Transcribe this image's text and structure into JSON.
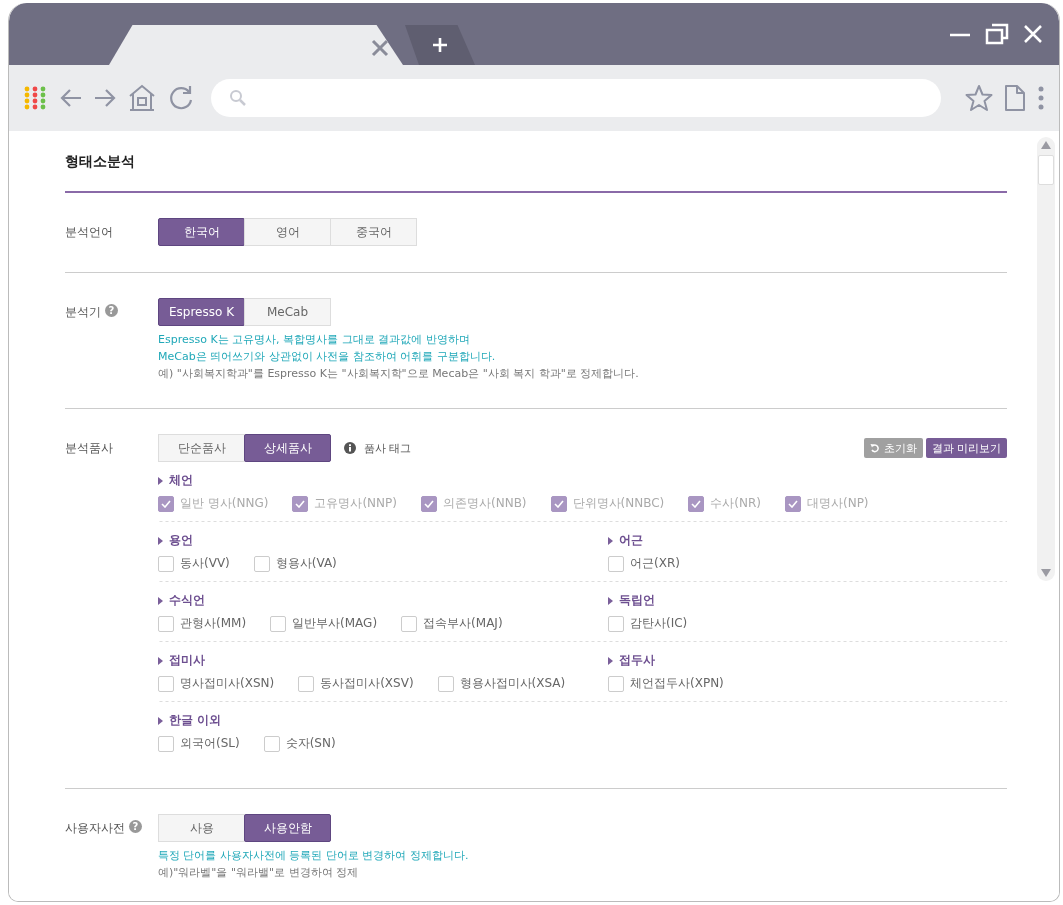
{
  "page_title": "형태소분석",
  "language": {
    "label": "분석언어",
    "options": [
      {
        "label": "한국어",
        "selected": true
      },
      {
        "label": "영어",
        "selected": false
      },
      {
        "label": "중국어",
        "selected": false
      }
    ]
  },
  "analyzer": {
    "label": "분석기",
    "help": "?",
    "options": [
      {
        "label": "Espresso K",
        "selected": true
      },
      {
        "label": "MeCab",
        "selected": false
      }
    ],
    "notes": [
      {
        "text": "Espresso K는 고유명사, 복합명사를 그대로 결과값에 반영하며",
        "kind": "highlight"
      },
      {
        "text": "MeCab은 띄어쓰기와 상관없이 사전을 참조하여 어휘를 구분합니다.",
        "kind": "highlight"
      },
      {
        "text": "예) \"사회복지학과\"를 Espresso K는 \"사회복지학\"으로 Mecab은 \"사회 복지 학과\"로 정제합니다.",
        "kind": "plain"
      }
    ]
  },
  "pos": {
    "label": "분석품사",
    "options": [
      {
        "label": "단순품사",
        "selected": false
      },
      {
        "label": "상세품사",
        "selected": true
      }
    ],
    "tag_link": "품사 태그",
    "reset": "초기화",
    "preview": "결과 미리보기",
    "rows": [
      [
        {
          "title": "체언",
          "items": [
            {
              "label": "일반 명사(NNG)",
              "checked": true,
              "disabled": true
            },
            {
              "label": "고유명사(NNP)",
              "checked": true,
              "disabled": true
            },
            {
              "label": "의존명사(NNB)",
              "checked": true,
              "disabled": true
            },
            {
              "label": "단위명사(NNBC)",
              "checked": true,
              "disabled": true
            },
            {
              "label": "수사(NR)",
              "checked": true,
              "disabled": true
            },
            {
              "label": "대명사(NP)",
              "checked": true,
              "disabled": true
            }
          ]
        }
      ],
      [
        {
          "title": "용언",
          "items": [
            {
              "label": "동사(VV)",
              "checked": false,
              "disabled": false
            },
            {
              "label": "형용사(VA)",
              "checked": false,
              "disabled": false
            }
          ]
        },
        {
          "title": "어근",
          "items": [
            {
              "label": "어근(XR)",
              "checked": false,
              "disabled": false
            }
          ]
        }
      ],
      [
        {
          "title": "수식언",
          "items": [
            {
              "label": "관형사(MM)",
              "checked": false,
              "disabled": false
            },
            {
              "label": "일반부사(MAG)",
              "checked": false,
              "disabled": false
            },
            {
              "label": "접속부사(MAJ)",
              "checked": false,
              "disabled": false
            }
          ]
        },
        {
          "title": "독립언",
          "items": [
            {
              "label": "감탄사(IC)",
              "checked": false,
              "disabled": false
            }
          ]
        }
      ],
      [
        {
          "title": "접미사",
          "items": [
            {
              "label": "명사접미사(XSN)",
              "checked": false,
              "disabled": false
            },
            {
              "label": "동사접미사(XSV)",
              "checked": false,
              "disabled": false
            },
            {
              "label": "형용사접미사(XSA)",
              "checked": false,
              "disabled": false
            }
          ]
        },
        {
          "title": "접두사",
          "items": [
            {
              "label": "체언접두사(XPN)",
              "checked": false,
              "disabled": false
            }
          ]
        }
      ],
      [
        {
          "title": "한글 이외",
          "items": [
            {
              "label": "외국어(SL)",
              "checked": false,
              "disabled": false
            },
            {
              "label": "숫자(SN)",
              "checked": false,
              "disabled": false
            }
          ]
        }
      ]
    ]
  },
  "user_dict": {
    "label": "사용자사전",
    "help": "?",
    "options": [
      {
        "label": "사용",
        "selected": false
      },
      {
        "label": "사용안함",
        "selected": true
      }
    ],
    "notes": [
      {
        "text": "특정 단어를 사용자사전에 등록된 단어로 변경하여 정제합니다.",
        "kind": "highlight"
      },
      {
        "text": "예)\"워라벨\"을 \"워라밸\"로 변경하여 정제",
        "kind": "plain"
      }
    ]
  }
}
